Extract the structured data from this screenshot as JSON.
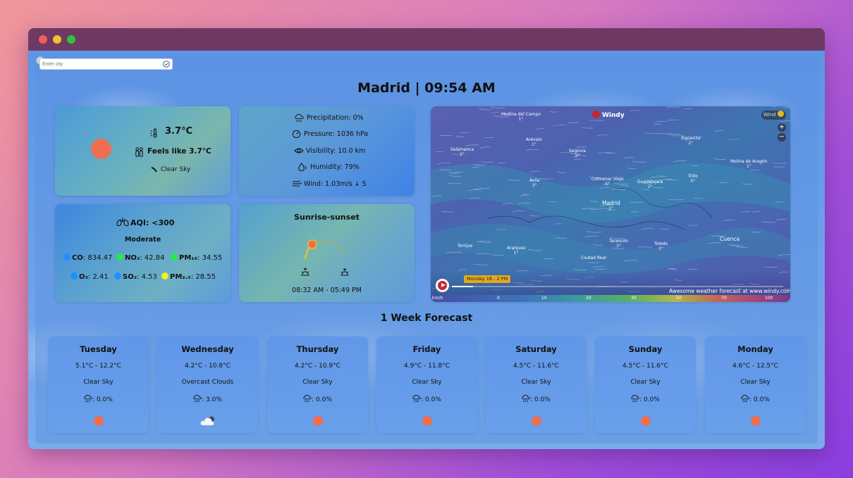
{
  "search": {
    "placeholder": "Enter city"
  },
  "header": {
    "city_time": "Madrid | 09:54 AM"
  },
  "current": {
    "temperature": "3.7°C",
    "feels_like": "Feels like 3.7°C",
    "condition": "Clear Sky",
    "sun_color": "#ee6e4f"
  },
  "details": {
    "precipitation": "Precipitation: 0%",
    "pressure": "Pressure: 1036 hPa",
    "visibility": "Visibility: 10.0 km",
    "humidity": "Humidity: 79%",
    "wind": "Wind: 1.03m/s ↓ S"
  },
  "aqi": {
    "title": "AQI: <300",
    "status": "Moderate",
    "pollutants": [
      {
        "label": "CO",
        "value": ": 834.47",
        "color": "#1e8fff"
      },
      {
        "label": "NO₂",
        "value": ": 42.84",
        "color": "#22ee44"
      },
      {
        "label": "PM₁₀",
        "value": ": 34.55",
        "color": "#22ee44"
      },
      {
        "label": "O₃",
        "value": ": 2.41",
        "color": "#1e8fff"
      },
      {
        "label": "SO₂",
        "value": ": 4.53",
        "color": "#1e8fff"
      },
      {
        "label": "PM₂.₅",
        "value": ": 28.55",
        "color": "#f5f020"
      }
    ]
  },
  "sun": {
    "title": "Sunrise-sunset",
    "times": "08:32 AM - 05:49 PM"
  },
  "map": {
    "brand": "Windy",
    "layer_label": "Wind",
    "zoom_in": "+",
    "zoom_out": "−",
    "timeline_label": "Monday 18 - 2 PM",
    "attribution": "Awesome weather forecast at www.windy.com",
    "scale_unit": "km/h",
    "scale_ticks": [
      "0",
      "10",
      "20",
      "30",
      "50",
      "70",
      "100"
    ],
    "places": [
      {
        "name": "Medina del Campo",
        "value": "1°"
      },
      {
        "name": "Salamanca",
        "value": "2°"
      },
      {
        "name": "Arévalo",
        "value": "1°"
      },
      {
        "name": "Segovia",
        "value": "3°"
      },
      {
        "name": "Sigüenza",
        "value": "2°"
      },
      {
        "name": "Molina de Aragón",
        "value": "1°"
      },
      {
        "name": "Ávila",
        "value": "3°"
      },
      {
        "name": "Colmenar Viejo",
        "value": "5°"
      },
      {
        "name": "Guadalajara",
        "value": "2°"
      },
      {
        "name": "Trillo",
        "value": "0°"
      },
      {
        "name": "Madrid",
        "value": "1°"
      },
      {
        "name": "Cuenca",
        "value": ""
      },
      {
        "name": "Torrijos",
        "value": ""
      },
      {
        "name": "Aranjuez",
        "value": "1°"
      },
      {
        "name": "Tarancón",
        "value": "3°"
      },
      {
        "name": "Toledo",
        "value": "3°"
      },
      {
        "name": "Ciudad Real",
        "value": ""
      }
    ]
  },
  "forecast": {
    "title": "1 Week Forecast",
    "days": [
      {
        "name": "Tuesday",
        "range": "5.1°C - 12.2°C",
        "desc": "Clear Sky",
        "precip": ": 0.0%",
        "icon": "sun"
      },
      {
        "name": "Wednesday",
        "range": "4.2°C - 10.8°C",
        "desc": "Overcast Clouds",
        "precip": ": 3.0%",
        "icon": "cloud"
      },
      {
        "name": "Thursday",
        "range": "4.2°C - 10.9°C",
        "desc": "Clear Sky",
        "precip": ": 0.0%",
        "icon": "sun"
      },
      {
        "name": "Friday",
        "range": "4.9°C - 11.8°C",
        "desc": "Clear Sky",
        "precip": ": 0.0%",
        "icon": "sun"
      },
      {
        "name": "Saturday",
        "range": "4.5°C - 11.6°C",
        "desc": "Clear Sky",
        "precip": ": 0.0%",
        "icon": "sun"
      },
      {
        "name": "Sunday",
        "range": "4.5°C - 11.6°C",
        "desc": "Clear Sky",
        "precip": ": 0.0%",
        "icon": "sun"
      },
      {
        "name": "Monday",
        "range": "4.6°C - 12.5°C",
        "desc": "Clear Sky",
        "precip": ": 0.0%",
        "icon": "sun"
      }
    ]
  }
}
